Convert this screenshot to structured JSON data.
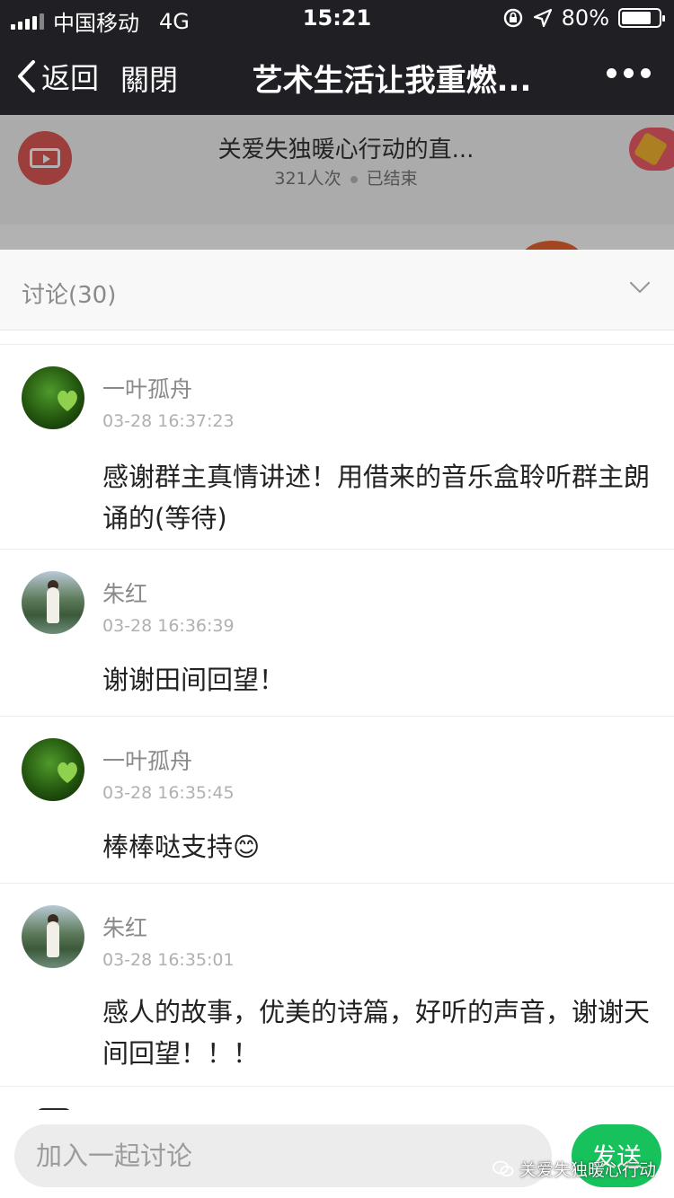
{
  "status_bar": {
    "carrier": "中国移动",
    "network": "4G",
    "time": "15:21",
    "battery": "80%",
    "battery_level": 0.8
  },
  "nav": {
    "back_label": "返回",
    "close_label": "關閉",
    "title": "艺术生活让我重燃..."
  },
  "live": {
    "title": "关爱失独暖心行动的直...",
    "views": "321人次",
    "status": "已结束"
  },
  "discussion": {
    "title": "讨论(30)",
    "comments": [
      {
        "avatar": "leaf-avatar",
        "name": "一叶孤舟",
        "time": "03-28 16:37:23",
        "text": "感谢群主真情讲述！用借来的音乐盒聆听群主朗诵的(等待)"
      },
      {
        "avatar": "photo-avatar",
        "name": "朱红",
        "time": "03-28 16:36:39",
        "text": "谢谢田间回望！"
      },
      {
        "avatar": "leaf-avatar",
        "name": "一叶孤舟",
        "time": "03-28 16:35:45",
        "text": "棒棒哒支持😊"
      },
      {
        "avatar": "photo-avatar",
        "name": "朱红",
        "time": "03-28 16:35:01",
        "text": "感人的故事，优美的诗篇，好听的声音，谢谢天间回望！！！"
      }
    ]
  },
  "input": {
    "placeholder": "加入一起讨论",
    "send_label": "发送"
  },
  "watermark": "关爱失独暖心行动",
  "colors": {
    "nav_bg": "#1f1f24",
    "send_green": "#17c15b",
    "live_logo_red": "#e05a55",
    "badge_pink": "#f25d6c"
  }
}
